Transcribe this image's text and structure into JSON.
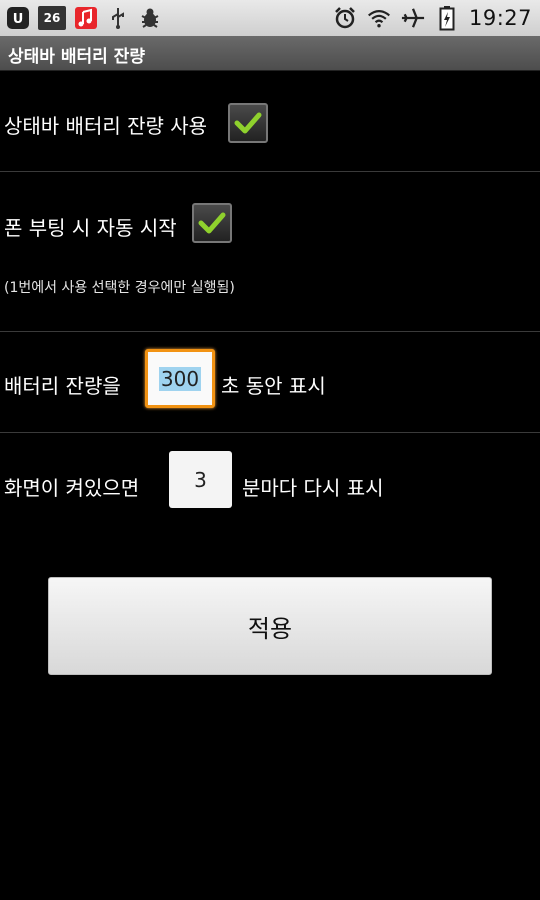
{
  "status_bar": {
    "badge": "26",
    "time": "19:27",
    "icons": [
      "ut-icon",
      "calendar-icon",
      "music-icon",
      "usb-icon",
      "bug-icon",
      "alarm-icon",
      "wifi-icon",
      "airplane-icon",
      "battery-icon"
    ]
  },
  "title": "상태바 배터리 잔량",
  "settings": {
    "use_statusbar_label": "상태바 배터리 잔량 사용",
    "use_statusbar_checked": true,
    "boot_start_label": "폰 부팅 시 자동 시작",
    "boot_start_checked": true,
    "boot_note": "(1번에서 사용 선택한 경우에만 실행됨)",
    "display_prefix": "배터리 잔량을",
    "display_seconds": "300",
    "display_suffix": "초 동안 표시",
    "repeat_prefix": "화면이 켜있으면",
    "repeat_minutes": "3",
    "repeat_suffix": "분마다 다시 표시"
  },
  "apply_label": "적용",
  "colors": {
    "check": "#8fd12d",
    "focus": "#f29313",
    "selection": "#9fd3ef"
  }
}
